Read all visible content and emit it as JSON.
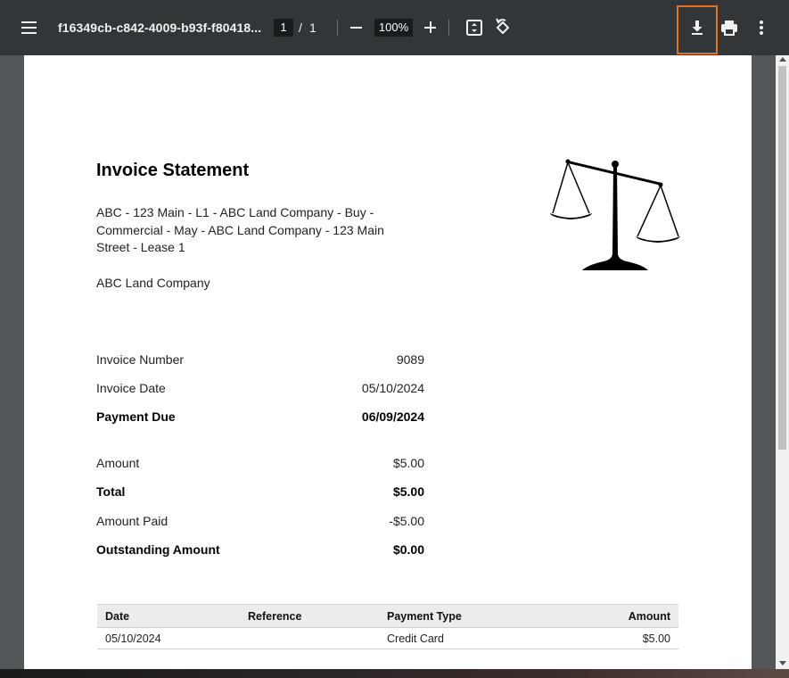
{
  "toolbar": {
    "doc_title": "f16349cb-c842-4009-b93f-f80418...",
    "page_current": "1",
    "page_separator": "/",
    "page_total": "1",
    "zoom": "100%",
    "icons": [
      "menu-icon",
      "zoom-out-icon",
      "zoom-in-icon",
      "fit-page-icon",
      "rotate-icon",
      "download-icon",
      "print-icon",
      "more-vert-icon"
    ],
    "highlight_color": "#e8711f",
    "bg_color": "#323639"
  },
  "invoice": {
    "title": "Invoice Statement",
    "description": "ABC - 123 Main - L1 - ABC Land Company - Buy - Commercial - May - ABC Land Company - 123 Main Street - Lease 1",
    "company": "ABC Land Company",
    "logo": "scales-of-justice-logo",
    "details": [
      {
        "label": "Invoice Number",
        "value": "9089",
        "bold": false
      },
      {
        "label": "Invoice Date",
        "value": "05/10/2024",
        "bold": false
      },
      {
        "label": "Payment Due",
        "value": "06/09/2024",
        "bold": true
      }
    ],
    "totals": [
      {
        "label": "Amount",
        "value": "$5.00",
        "bold": false
      },
      {
        "label": "Total",
        "value": "$5.00",
        "bold": true
      },
      {
        "label": "Amount Paid",
        "value": "-$5.00",
        "bold": false
      },
      {
        "label": "Outstanding Amount",
        "value": "$0.00",
        "bold": true
      }
    ],
    "payments_table": {
      "headers": [
        "Date",
        "Reference",
        "Payment Type",
        "Amount"
      ],
      "rows": [
        [
          "05/10/2024",
          "",
          "Credit Card",
          "$5.00"
        ]
      ]
    }
  }
}
